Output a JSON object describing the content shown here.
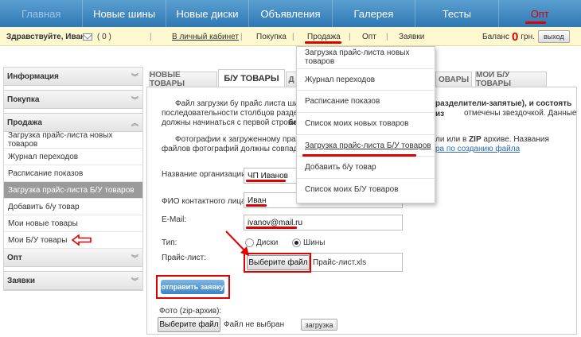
{
  "nav": {
    "items": [
      {
        "label": "Главная"
      },
      {
        "label": "Новые шины"
      },
      {
        "label": "Новые диски"
      },
      {
        "label": "Объявления"
      },
      {
        "label": "Галерея"
      },
      {
        "label": "Тесты"
      },
      {
        "label": "Опт"
      }
    ]
  },
  "userbar": {
    "greeting": "Здравствуйте, Иван",
    "mail_count": "( 0 )",
    "cabinet": "В личный кабинет",
    "links": [
      "Покупка",
      "Продажа",
      "Опт",
      "Заявки"
    ],
    "balance_label": "Баланс",
    "balance_value": "0",
    "balance_unit": "грн.",
    "exit": "выход"
  },
  "sidebar": {
    "info": "Информация",
    "purchase": "Покупка",
    "sale": "Продажа",
    "sale_items": [
      "Загрузка прайс-листа новых товаров",
      "Журнал переходов",
      "Расписание показов",
      "Загрузка прайс-листа Б/У товаров",
      "Добавить б/у товар",
      "Мои новые товары",
      "Мои Б/У товары"
    ],
    "wholesale": "Опт",
    "requests": "Заявки"
  },
  "tabs": {
    "new_goods": "НОВЫЕ ТОВАРЫ",
    "used_goods": "Б/У ТОВАРЫ",
    "hidden_letter": "Д",
    "goods_partial": "ОВАРЫ",
    "my_used": "МОИ Б/У ТОВАРЫ"
  },
  "content": {
    "para1_line1a": "Файл загрузки бу прайс листа шин и",
    "para1_line1b": "разделители-запятые), и состоять из",
    "para1_line2a": "последовательности столбцов разделе",
    "para1_line2b": "отмечены звездочкой. Данные",
    "para1_line3a": "должны начинаться с первой строки",
    "para1_line3b": "бе",
    "para2_line1a": "Фотографии к загруженному прайс л",
    "para2_line1b": "ли или в",
    "para2_line1c": "ZIP",
    "para2_line1d": "архиве. Названия",
    "para2_line2a": "файлов фотографий должны совпадать",
    "para2_line2b": "ра по созданию файла"
  },
  "form": {
    "org_label": "Название организации:",
    "org_value": "ЧП Иванов",
    "contact_label": "ФИО контактного лица:",
    "contact_value": "Иван",
    "email_label": "E-Mail:",
    "email_value": "ivanov@mail.ru",
    "type_label": "Тип:",
    "type_options": [
      "Диски",
      "Шины"
    ],
    "price_label": "Прайс-лист:",
    "choose_file": "Выберите файл",
    "price_file": "Прайс-лист.xls",
    "submit": "отправить заявку",
    "photo_label": "Фото (zip-архив):",
    "photo_choose": "Выберите файл",
    "photo_file": "Файл не выбран",
    "upload": "загрузка"
  },
  "dropdown": {
    "items": [
      "Загрузка прайс-листа новых товаров",
      "Журнал переходов",
      "Расписание показов",
      "Список моих новых товаров",
      "Загрузка прайс-листа Б/У товаров",
      "Добавить б/у товар",
      "Список моих Б/У товаров"
    ]
  },
  "colors": {
    "nav_blue": "#3a84c4",
    "annotation_red": "#e00000",
    "userbar_yellow": "#fdf8cf",
    "link_blue": "#2a6bb0"
  }
}
